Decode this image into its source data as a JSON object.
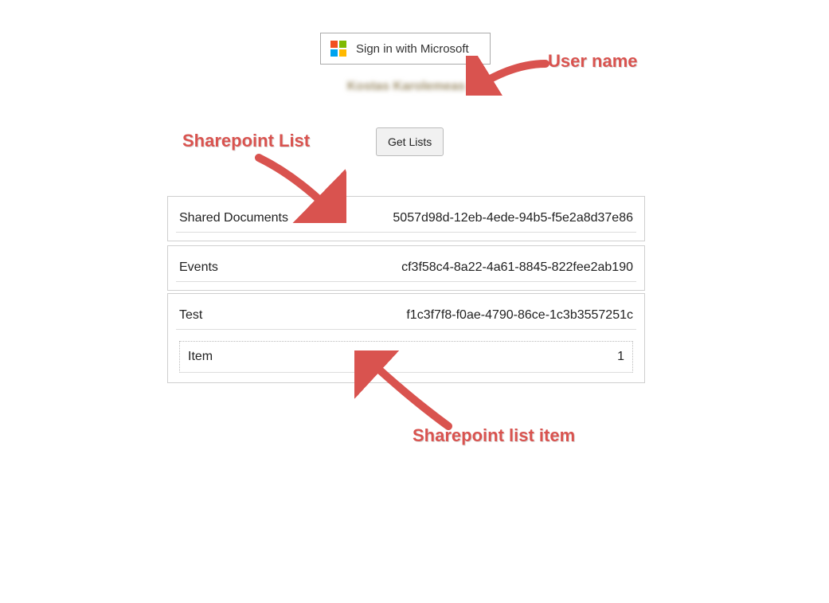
{
  "signin": {
    "label": "Sign in with Microsoft"
  },
  "user": {
    "display_name": "Kostas Karolemeas"
  },
  "actions": {
    "get_lists": "Get Lists"
  },
  "lists": [
    {
      "name": "Shared Documents",
      "id": "5057d98d-12eb-4ede-94b5-f5e2a8d37e86"
    },
    {
      "name": "Events",
      "id": "cf3f58c4-8a22-4a61-8845-822fee2ab190"
    },
    {
      "name": "Test",
      "id": "f1c3f7f8-f0ae-4790-86ce-1c3b3557251c",
      "items": [
        {
          "label": "Item",
          "value": "1"
        }
      ]
    }
  ],
  "annotations": {
    "user_name": "User name",
    "sp_list": "Sharepoint List",
    "sp_item": "Sharepoint list item"
  }
}
